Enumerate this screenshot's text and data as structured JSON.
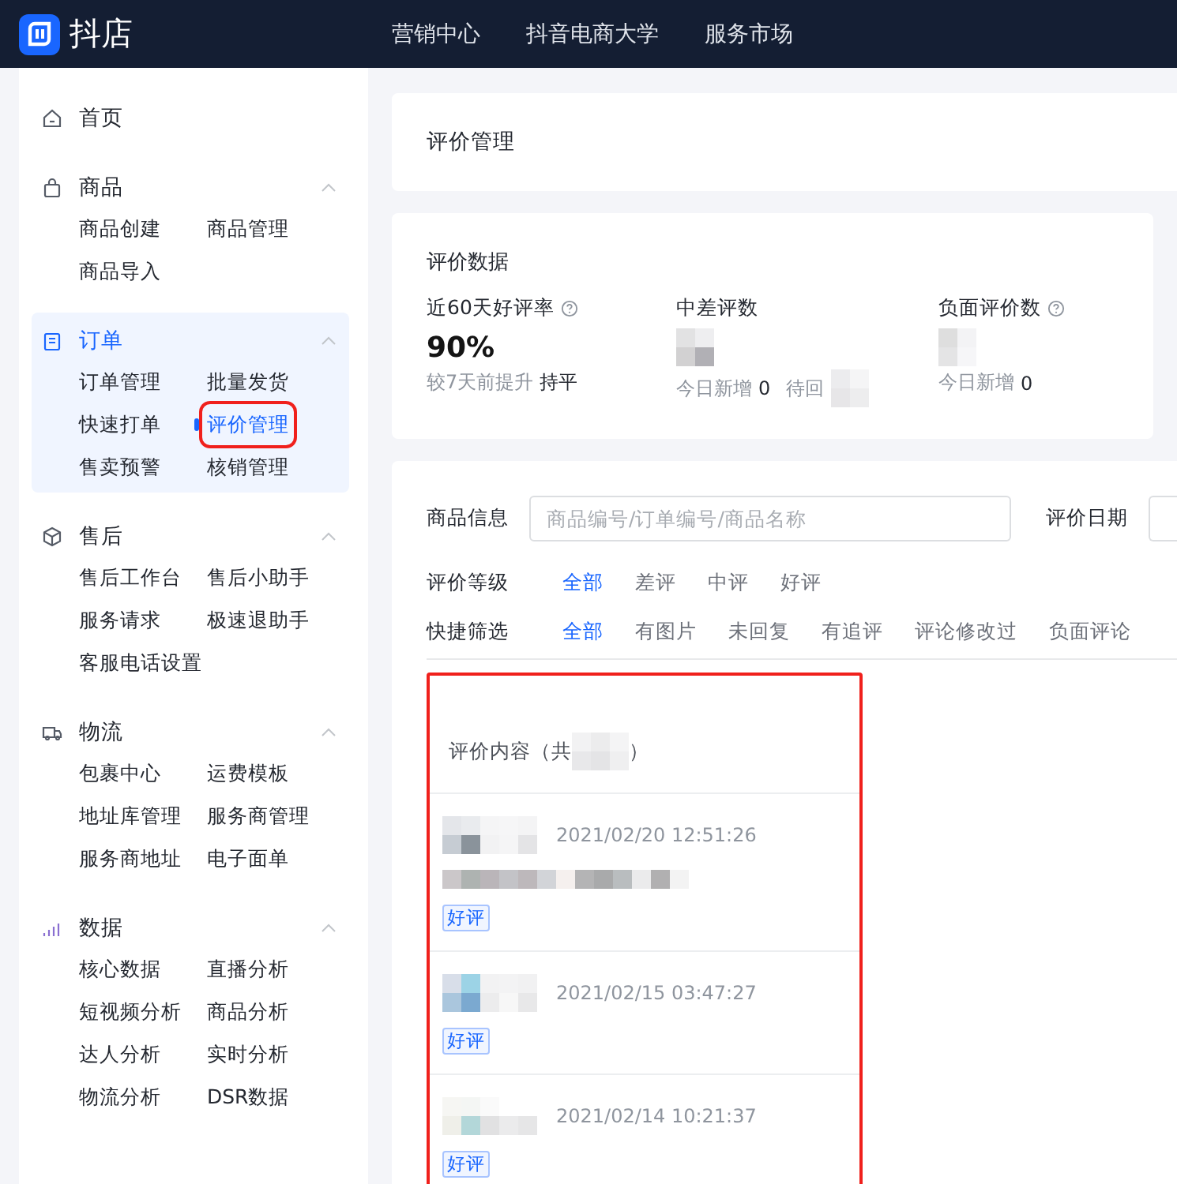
{
  "topbar": {
    "brand": "抖店",
    "nav": [
      "营销中心",
      "抖音电商大学",
      "服务市场"
    ]
  },
  "sidebar": {
    "items": [
      {
        "kind": "home",
        "title": "首页",
        "selected": false
      },
      {
        "kind": "goods",
        "title": "商品",
        "selected": false,
        "expanded": true,
        "children": [
          {
            "label": "商品创建",
            "selected": false
          },
          {
            "label": "商品管理",
            "selected": false
          },
          {
            "label": "商品导入",
            "selected": false
          }
        ]
      },
      {
        "kind": "order",
        "title": "订单",
        "selected": true,
        "expanded": true,
        "children": [
          {
            "label": "订单管理",
            "selected": false
          },
          {
            "label": "批量发货",
            "selected": false
          },
          {
            "label": "快速打单",
            "selected": false
          },
          {
            "label": "评价管理",
            "selected": true,
            "highlighted": true
          },
          {
            "label": "售卖预警",
            "selected": false
          },
          {
            "label": "核销管理",
            "selected": false
          }
        ]
      },
      {
        "kind": "aftersale",
        "title": "售后",
        "selected": false,
        "expanded": true,
        "children": [
          {
            "label": "售后工作台",
            "selected": false
          },
          {
            "label": "售后小助手",
            "selected": false
          },
          {
            "label": "服务请求",
            "selected": false
          },
          {
            "label": "极速退助手",
            "selected": false
          },
          {
            "label": "客服电话设置",
            "selected": false
          }
        ]
      },
      {
        "kind": "logistics",
        "title": "物流",
        "selected": false,
        "expanded": true,
        "children": [
          {
            "label": "包裹中心",
            "selected": false
          },
          {
            "label": "运费模板",
            "selected": false
          },
          {
            "label": "地址库管理",
            "selected": false
          },
          {
            "label": "服务商管理",
            "selected": false
          },
          {
            "label": "服务商地址",
            "selected": false
          },
          {
            "label": "电子面单",
            "selected": false
          }
        ]
      },
      {
        "kind": "data",
        "title": "数据",
        "selected": false,
        "expanded": true,
        "children": [
          {
            "label": "核心数据",
            "selected": false
          },
          {
            "label": "直播分析",
            "selected": false
          },
          {
            "label": "短视频分析",
            "selected": false
          },
          {
            "label": "商品分析",
            "selected": false
          },
          {
            "label": "达人分析",
            "selected": false
          },
          {
            "label": "实时分析",
            "selected": false
          },
          {
            "label": "物流分析",
            "selected": false
          },
          {
            "label": "DSR数据",
            "selected": false
          }
        ]
      }
    ]
  },
  "page_title": "评价管理",
  "stats": {
    "title": "评价数据",
    "items": [
      {
        "label": "近60天好评率",
        "help": true,
        "value": "90%",
        "sub": [
          {
            "text": "较7天前提升",
            "kind": "muted"
          },
          {
            "text": "持平",
            "kind": "strong"
          }
        ]
      },
      {
        "label": "中差评数",
        "help": false,
        "sub": [
          {
            "text": "今日新增",
            "kind": "muted"
          },
          {
            "text": "0",
            "kind": "strong"
          },
          {
            "text": "待回",
            "kind": "muted"
          },
          {
            "kind": "redacted"
          }
        ]
      },
      {
        "label": "负面评价数",
        "help": true,
        "sub": [
          {
            "text": "今日新增",
            "kind": "muted"
          },
          {
            "text": "0",
            "kind": "strong"
          }
        ]
      }
    ]
  },
  "filters": {
    "search_label": "商品信息",
    "search_placeholder": "商品编号/订单编号/商品名称",
    "date_label": "评价日期",
    "grade_label": "评价等级",
    "grades": [
      {
        "label": "全部",
        "selected": true
      },
      {
        "label": "差评",
        "selected": false
      },
      {
        "label": "中评",
        "selected": false
      },
      {
        "label": "好评",
        "selected": false
      }
    ],
    "quick_label": "快捷筛选",
    "quick": [
      {
        "label": "全部",
        "selected": true
      },
      {
        "label": "有图片",
        "selected": false
      },
      {
        "label": "未回复",
        "selected": false
      },
      {
        "label": "有追评",
        "selected": false
      },
      {
        "label": "评论修改过",
        "selected": false
      },
      {
        "label": "负面评论",
        "selected": false
      }
    ]
  },
  "reviews": {
    "highlighted": true,
    "heading_start": "评价内容（共",
    "heading_end": "）",
    "items": [
      {
        "time": "2021/02/20 12:51:26",
        "has_content": true,
        "tag": "好评"
      },
      {
        "time": "2021/02/15 03:47:27",
        "has_content": false,
        "tag": "好评"
      },
      {
        "time": "2021/02/14 10:21:37",
        "has_content": false,
        "tag": "好评"
      }
    ]
  }
}
